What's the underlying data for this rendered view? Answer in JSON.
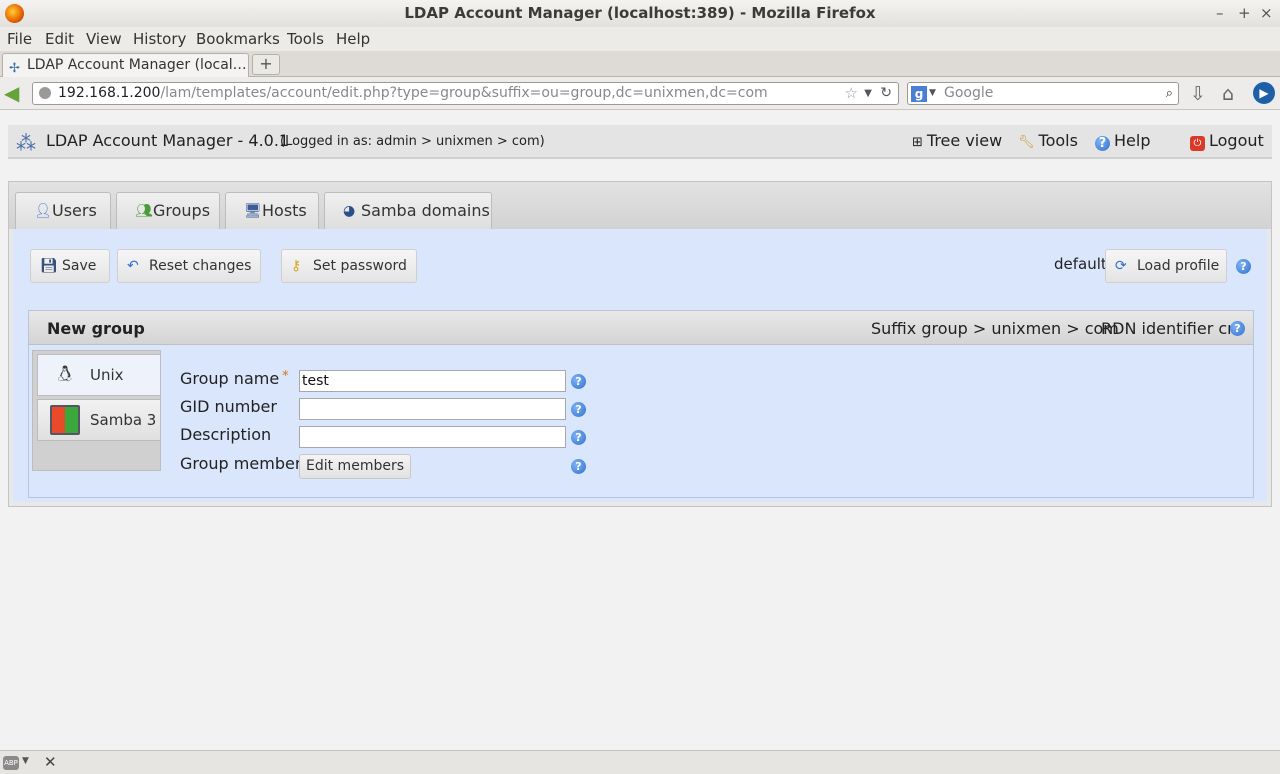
{
  "window": {
    "title": "LDAP Account Manager (localhost:389) - Mozilla Firefox",
    "controls": [
      "–",
      "+",
      "×"
    ]
  },
  "menu": [
    "File",
    "Edit",
    "View",
    "History",
    "Bookmarks",
    "Tools",
    "Help"
  ],
  "browser_tab": {
    "label": "LDAP Account Manager (local…",
    "new_tab": "+"
  },
  "nav": {
    "url_host": "192.168.1.200",
    "url_path": "/lam/templates/account/edit.php?type=group&suffix=ou=group,dc=unixmen,dc=com",
    "search_placeholder": "Google"
  },
  "lam": {
    "title": "LDAP Account Manager - 4.0.1",
    "logged_in": "(Logged in as: admin > unixmen > com)",
    "links": {
      "tree_view": "Tree view",
      "tools": "Tools",
      "help": "Help",
      "logout": "Logout"
    },
    "type_tabs": [
      "Users",
      "Groups",
      "Hosts",
      "Samba domains"
    ],
    "buttons": {
      "save": "Save",
      "reset": "Reset changes",
      "set_password": "Set password",
      "load_profile": "Load profile"
    },
    "profile_value": "default",
    "panel": {
      "title": "New group",
      "suffix": "Suffix group > unixmen > com",
      "rdn": "RDN identifier cn"
    },
    "modules": [
      "Unix",
      "Samba 3"
    ],
    "form": {
      "group_name_label": "Group name",
      "group_name_required": "*",
      "group_name_value": "test",
      "gid_label": "GID number",
      "gid_value": "",
      "description_label": "Description",
      "description_value": "",
      "members_label": "Group members",
      "edit_members": "Edit members"
    }
  },
  "colors": {
    "accent_blue": "#d9e6fb",
    "required_marker": "#e07010",
    "help_icon": "#2f6fcf"
  }
}
